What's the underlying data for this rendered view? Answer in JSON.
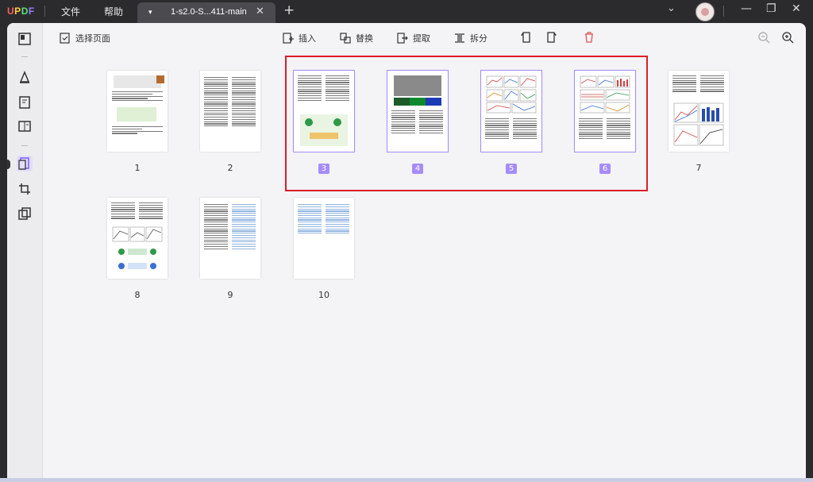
{
  "app": {
    "logo": "UPDF",
    "menu": [
      "文件",
      "帮助"
    ],
    "tab_title": "1-s2.0-S...411-main"
  },
  "toolbar": {
    "select_pages": "选择页面",
    "insert": "插入",
    "replace": "替换",
    "extract": "提取",
    "split": "拆分"
  },
  "pages": [
    {
      "num": "1",
      "selected": false,
      "kind": "cover"
    },
    {
      "num": "2",
      "selected": false,
      "kind": "text"
    },
    {
      "num": "3",
      "selected": true,
      "kind": "text-figure"
    },
    {
      "num": "4",
      "selected": true,
      "kind": "micrograph"
    },
    {
      "num": "5",
      "selected": true,
      "kind": "plots"
    },
    {
      "num": "6",
      "selected": true,
      "kind": "plots"
    },
    {
      "num": "7",
      "selected": false,
      "kind": "plots-bars"
    },
    {
      "num": "8",
      "selected": false,
      "kind": "plots-scheme"
    },
    {
      "num": "9",
      "selected": false,
      "kind": "text-blue"
    },
    {
      "num": "10",
      "selected": false,
      "kind": "refs-blue"
    }
  ],
  "colors": {
    "accent": "#a68bff",
    "highlight_box": "#dc1e28",
    "delete": "#e05555"
  }
}
